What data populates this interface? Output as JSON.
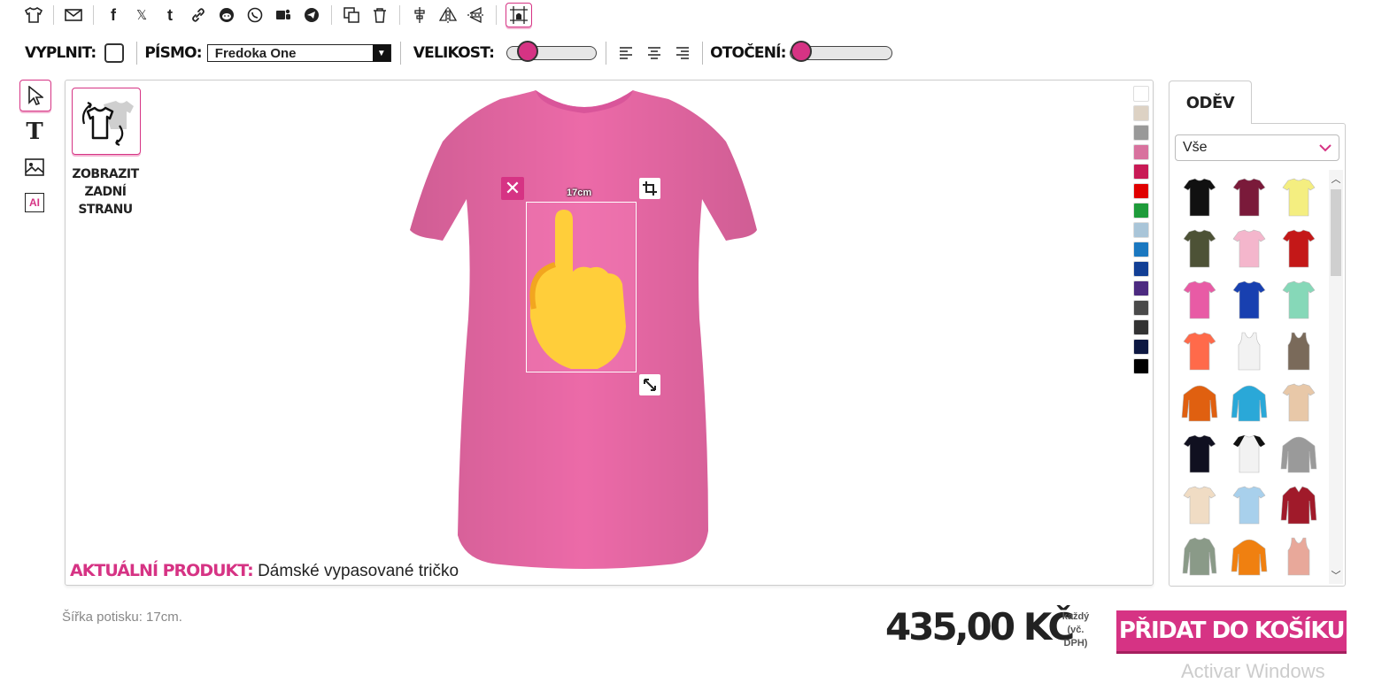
{
  "toolbar": {
    "icons": [
      "tshirt-icon",
      "email-icon",
      "facebook-icon",
      "x-twitter-icon",
      "tumblr-icon",
      "link-icon",
      "reddit-icon",
      "whatsapp-icon",
      "teams-icon",
      "telegram-icon",
      "copy-icon",
      "trash-icon",
      "align-center-vertical-icon",
      "flip-horizontal-icon",
      "flip-vertical-icon",
      "print-area-grid-icon"
    ],
    "social_glyphs": {
      "facebook": "f",
      "x": "𝕏",
      "tumblr": "t"
    }
  },
  "options": {
    "fill_label": "VYPLNIT:",
    "font_label": "PÍSMO:",
    "font_value": "Fredoka One",
    "size_label": "VELIKOST:",
    "rotation_label": "OTOČENÍ:"
  },
  "left_tools": {
    "text_glyph": "T",
    "ai_label": "AI"
  },
  "canvas": {
    "back_side_label": "ZOBRAZIT ZADNÍ STRANU",
    "product_label": "AKTUÁLNÍ PRODUKT:",
    "product_name": "Dámské vypasované tričko",
    "dimension_label": "17cm",
    "shirt_color": "#ec6aa8",
    "swatches": [
      "#ffffff",
      "#ddd2c4",
      "#999999",
      "#d8729e",
      "#c81a55",
      "#e00000",
      "#1e9b3a",
      "#a9c5d8",
      "#1b78c0",
      "#123f95",
      "#4c2a80",
      "#4a4a4a",
      "#333333",
      "#0d1842",
      "#000000"
    ]
  },
  "right_panel": {
    "tab_label": "ODĚV",
    "filter_value": "Vše",
    "garments": [
      {
        "type": "tee",
        "color": "#111111"
      },
      {
        "type": "tee",
        "color": "#7a1a3a"
      },
      {
        "type": "tee",
        "color": "#f4ee80"
      },
      {
        "type": "tee",
        "color": "#4d5236"
      },
      {
        "type": "tee",
        "color": "#f4b6cc"
      },
      {
        "type": "tee",
        "color": "#c41818"
      },
      {
        "type": "tee",
        "color": "#e85ba5"
      },
      {
        "type": "tee",
        "color": "#1840b0"
      },
      {
        "type": "tee",
        "color": "#86d8b8"
      },
      {
        "type": "tee",
        "color": "#ff6a4a"
      },
      {
        "type": "tank",
        "color": "#f2f2f2"
      },
      {
        "type": "tank",
        "color": "#7a6a5a"
      },
      {
        "type": "hoodie",
        "color": "#e06010"
      },
      {
        "type": "hoodie",
        "color": "#2aa8d8"
      },
      {
        "type": "tee",
        "color": "#e8c8a8"
      },
      {
        "type": "tee",
        "color": "#101020"
      },
      {
        "type": "raglan",
        "color": "#f2f2f2"
      },
      {
        "type": "hoodie",
        "color": "#9a9a9a"
      },
      {
        "type": "tee",
        "color": "#f0dcc4"
      },
      {
        "type": "tee",
        "color": "#a8d0ec"
      },
      {
        "type": "jacket",
        "color": "#a01a2a"
      },
      {
        "type": "longsleeve",
        "color": "#8a9a88"
      },
      {
        "type": "hoodie",
        "color": "#f08010"
      },
      {
        "type": "tank",
        "color": "#e8a89a"
      }
    ]
  },
  "footer": {
    "print_width": "Šířka potisku: 17cm.",
    "price": "435,00 KČ",
    "per_line1": "každý",
    "per_line2": "(vč.",
    "per_line3": "DPH)",
    "add_to_cart": "PŘIDAT DO KOŠÍKU",
    "watermark": "Activar Windows"
  },
  "colors": {
    "accent": "#d63384",
    "text": "#222222"
  }
}
